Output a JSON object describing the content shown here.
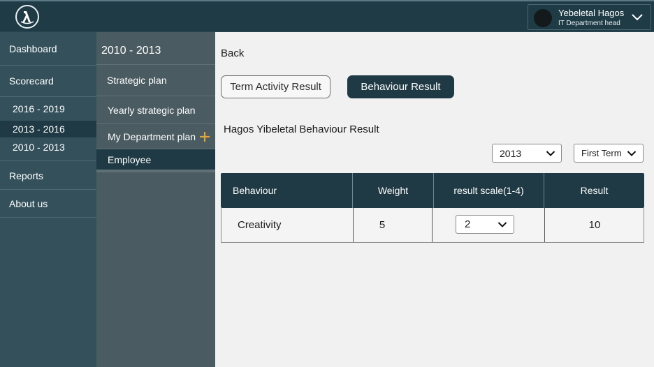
{
  "user": {
    "name": "Yebeletal Hagos",
    "role": "IT Department head"
  },
  "sidebar": {
    "items": [
      {
        "label": "Dashboard"
      },
      {
        "label": "Scorecard"
      },
      {
        "label": "2016 - 2019"
      },
      {
        "label": "2013 - 2016"
      },
      {
        "label": "2010 - 2013"
      },
      {
        "label": "Reports"
      },
      {
        "label": "About us"
      }
    ]
  },
  "subnav": {
    "title": "2010 - 2013",
    "items": [
      {
        "label": "Strategic plan"
      },
      {
        "label": "Yearly strategic plan"
      },
      {
        "label": "My Department plan"
      },
      {
        "label": "Employee"
      }
    ]
  },
  "main": {
    "back": "Back",
    "tab_term": "Term Activity Result",
    "tab_behaviour": "Behaviour Result",
    "section_title": "Hagos Yibeletal Behaviour Result",
    "year_select": "2013",
    "term_select": "First Term"
  },
  "table": {
    "headers": [
      "Behaviour",
      "Weight",
      "result scale(1-4)",
      "Result"
    ],
    "rows": [
      {
        "behaviour": "Creativity",
        "weight": "5",
        "scale": "2",
        "result": "10"
      }
    ]
  },
  "colors": {
    "accent": "#1f3a44",
    "plus": "#e0a53a"
  }
}
